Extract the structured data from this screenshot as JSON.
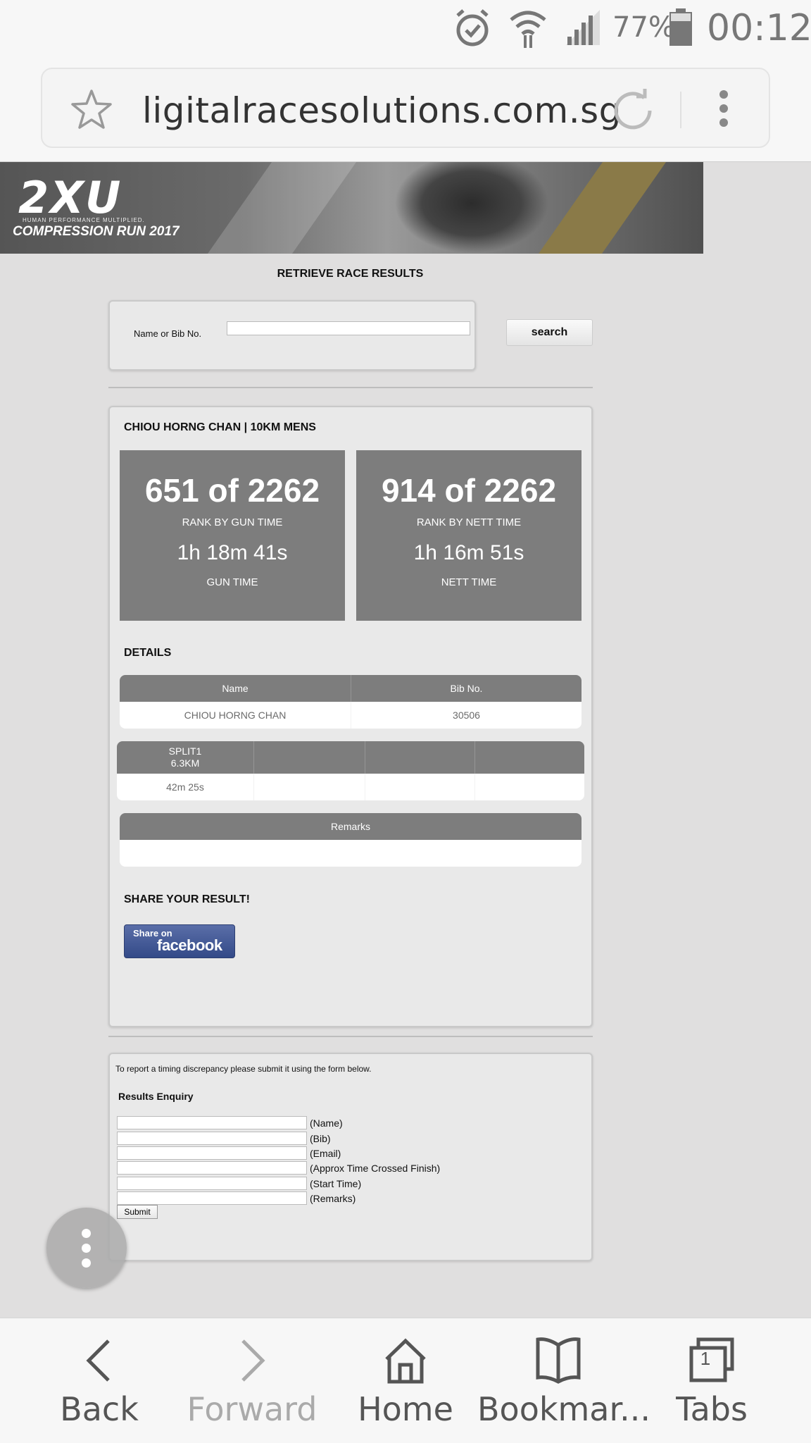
{
  "status_bar": {
    "battery_percent": "77%",
    "time": "00:12",
    "icons": [
      "alarm-icon",
      "wifi-icon",
      "signal-icon",
      "battery-icon"
    ]
  },
  "browser": {
    "url": "ligitalracesolutions.com.sg",
    "icons": [
      "star-icon",
      "reload-icon",
      "menu-icon"
    ]
  },
  "banner": {
    "logo": "2XU",
    "tagline": "HUMAN PERFORMANCE MULTIPLIED.",
    "event": "COMPRESSION RUN 2017"
  },
  "search": {
    "heading": "RETRIEVE RACE RESULTS",
    "label": "Name or Bib No.",
    "value": "",
    "button": "search"
  },
  "result": {
    "title": "CHIOU HORNG CHAN | 10KM MENS",
    "gun": {
      "rank": "651 of 2262",
      "rank_label": "RANK BY GUN TIME",
      "time": "1h 18m 41s",
      "time_label": "GUN TIME"
    },
    "nett": {
      "rank": "914 of 2262",
      "rank_label": "RANK BY NETT TIME",
      "time": "1h 16m 51s",
      "time_label": "NETT TIME"
    },
    "details_title": "DETAILS",
    "details_headers": [
      "Name",
      "Bib No."
    ],
    "details_row": [
      "CHIOU HORNG CHAN",
      "30506"
    ],
    "split_header": {
      "line1": "SPLIT1",
      "line2": "6.3KM"
    },
    "split_value": "42m 25s",
    "remarks_header": "Remarks",
    "remarks_value": "",
    "share_title": "SHARE YOUR RESULT!",
    "share_button": {
      "line1": "Share on",
      "line2": "facebook"
    }
  },
  "enquiry": {
    "note": "To report a timing discrepancy please submit it using the form below.",
    "title": "Results Enquiry",
    "fields": [
      "(Name)",
      "(Bib)",
      "(Email)",
      "(Approx Time Crossed Finish)",
      "(Start Time)",
      "(Remarks)"
    ],
    "submit": "Submit"
  },
  "bottom_nav": {
    "items": [
      "Back",
      "Forward",
      "Home",
      "Bookmar...",
      "Tabs"
    ],
    "tab_count": "1"
  },
  "colors": {
    "page_bg": "#e0dfdf",
    "stat_box": "#7d7d7d",
    "facebook": "#3b5998"
  }
}
